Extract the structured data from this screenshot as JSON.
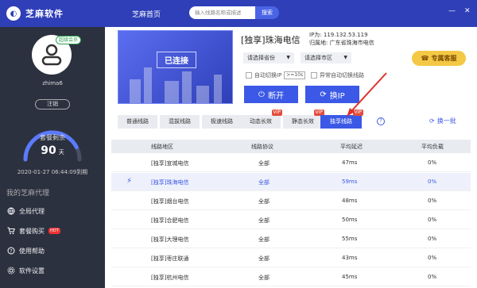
{
  "app": {
    "title": "芝麻软件",
    "home": "芝麻首页",
    "search_placeholder": "输入线路名称或描述",
    "search_button": "搜索"
  },
  "user": {
    "name": "zhima6",
    "badge": "超级会员",
    "logout": "注销"
  },
  "plan": {
    "label": "套餐剩余",
    "days": "90",
    "days_unit": "天",
    "expire": "2020-01-27  06:44:09到期",
    "progress": 0.85
  },
  "sidebar": {
    "section": "我的芝麻代理",
    "items": [
      {
        "label": "全局代理",
        "icon": "globe-icon"
      },
      {
        "label": "套餐购买",
        "icon": "cart-icon",
        "hot": "HOT"
      },
      {
        "label": "使用帮助",
        "icon": "help-icon"
      },
      {
        "label": "软件设置",
        "icon": "gear-icon"
      }
    ]
  },
  "connection": {
    "banner_text": "已连接",
    "title": "[独享]珠海电信",
    "ip": "IP为: 119.132.53.119",
    "location": "归属地: 广东省珠海市电信",
    "province_select": "请选择省份",
    "city_select": "请选择市区",
    "auto_switch": "自动切换IP",
    "interval": ">=10s",
    "abnormal_switch": "异常自动切换线路",
    "disconnect": "断开",
    "switch_ip": "换IP",
    "service": "专属客服"
  },
  "tabs": [
    {
      "label": "普通线路",
      "vip": false,
      "active": false
    },
    {
      "label": "混拔线路",
      "vip": false,
      "active": false
    },
    {
      "label": "极速线路",
      "vip": false,
      "active": false
    },
    {
      "label": "动态长效",
      "vip": true,
      "active": false
    },
    {
      "label": "静态长效",
      "vip": true,
      "active": false
    },
    {
      "label": "独享线路",
      "vip": true,
      "active": true
    }
  ],
  "vip_label": "VIP",
  "refresh": "换一批",
  "table": {
    "headers": [
      "线路地区",
      "线路协议",
      "平均延迟",
      "平均负载"
    ],
    "rows": [
      [
        "[独享]宣城电信",
        "全部",
        "47ms",
        "0%"
      ],
      [
        "[独享]珠海电信",
        "全部",
        "59ms",
        "0%"
      ],
      [
        "[独享]烟台电信",
        "全部",
        "48ms",
        "0%"
      ],
      [
        "[独享]合肥电信",
        "全部",
        "50ms",
        "0%"
      ],
      [
        "[独享]大理电信",
        "全部",
        "55ms",
        "0%"
      ],
      [
        "[独享]枣庄联通",
        "全部",
        "43ms",
        "0%"
      ],
      [
        "[独享]杭州电信",
        "全部",
        "45ms",
        "0%"
      ]
    ],
    "selected_index": 1
  }
}
